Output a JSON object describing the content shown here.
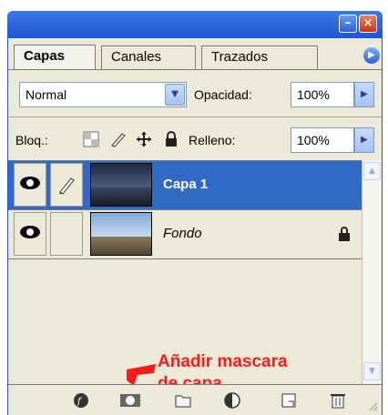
{
  "tabs": [
    {
      "label": "Capas",
      "active": true
    },
    {
      "label": "Canales",
      "active": false
    },
    {
      "label": "Trazados",
      "active": false
    }
  ],
  "blend": {
    "mode": "Normal",
    "opacity_label": "Opacidad:",
    "opacity_value": "100%"
  },
  "lock": {
    "label": "Bloq.:",
    "fill_label": "Relleno:",
    "fill_value": "100%",
    "icons": [
      "lock-transparent-pixels-icon",
      "lock-image-pixels-icon",
      "lock-position-icon",
      "lock-all-icon"
    ]
  },
  "layers": [
    {
      "name": "Capa 1",
      "selected": true,
      "visible": true,
      "locked": false
    },
    {
      "name": "Fondo",
      "selected": false,
      "visible": true,
      "locked": true
    }
  ],
  "annotation": {
    "line1": "Añadir mascara",
    "line2": "de capa",
    "color": "#ff1a1a"
  },
  "toolbar_icons": [
    "layer-style-icon",
    "add-layer-mask-icon",
    "new-group-icon",
    "adjustment-layer-icon",
    "new-layer-icon",
    "trash-icon"
  ],
  "colors": {
    "title_bar": "#1f55d6",
    "selection": "#316ac5",
    "panel_bg": "#ece9d8"
  }
}
